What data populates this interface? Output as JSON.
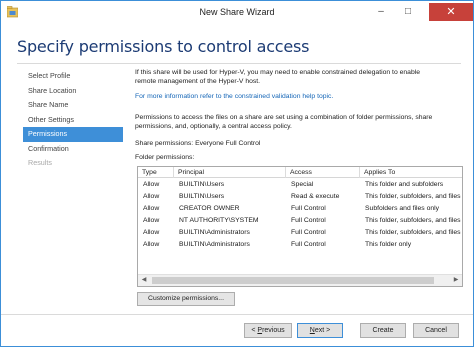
{
  "window": {
    "title": "New Share Wizard",
    "minimize": "–",
    "maximize": "□",
    "close": "✕"
  },
  "header": {
    "title": "Specify permissions to control access"
  },
  "nav": {
    "items": [
      {
        "label": "Select Profile",
        "state": "normal"
      },
      {
        "label": "Share Location",
        "state": "normal"
      },
      {
        "label": "Share Name",
        "state": "normal"
      },
      {
        "label": "Other Settings",
        "state": "normal"
      },
      {
        "label": "Permissions",
        "state": "active"
      },
      {
        "label": "Confirmation",
        "state": "normal"
      },
      {
        "label": "Results",
        "state": "disabled"
      }
    ]
  },
  "content": {
    "hyperv_line1": "If this share will be used for Hyper-V, you may need to enable constrained delegation to enable",
    "hyperv_line2": "remote management of the Hyper-V host.",
    "hyperv_link": "For more information refer to the constrained validation help topic.",
    "access_line1": "Permissions to access the files on a share are set using a combination of folder permissions, share",
    "access_line2": "permissions, and, optionally, a central access policy.",
    "share_permissions": "Share permissions: Everyone Full Control",
    "folder_permissions_label": "Folder permissions:"
  },
  "permissions_table": {
    "columns": [
      "Type",
      "Principal",
      "Access",
      "Applies To"
    ],
    "rows": [
      {
        "type": "Allow",
        "principal": "BUILTIN\\Users",
        "access": "Special",
        "applies_to": "This folder and subfolders"
      },
      {
        "type": "Allow",
        "principal": "BUILTIN\\Users",
        "access": "Read & execute",
        "applies_to": "This folder, subfolders, and files"
      },
      {
        "type": "Allow",
        "principal": "CREATOR OWNER",
        "access": "Full Control",
        "applies_to": "Subfolders and files only"
      },
      {
        "type": "Allow",
        "principal": "NT AUTHORITY\\SYSTEM",
        "access": "Full Control",
        "applies_to": "This folder, subfolders, and files"
      },
      {
        "type": "Allow",
        "principal": "BUILTIN\\Administrators",
        "access": "Full Control",
        "applies_to": "This folder, subfolders, and files"
      },
      {
        "type": "Allow",
        "principal": "BUILTIN\\Administrators",
        "access": "Full Control",
        "applies_to": "This folder only"
      }
    ]
  },
  "buttons": {
    "customize": "Customize permissions...",
    "previous_arrow": "< ",
    "previous_key": "P",
    "previous_rest": "revious",
    "next_key": "N",
    "next_rest": "ext >",
    "create": "Create",
    "cancel": "Cancel"
  },
  "icons": {
    "app": "share-folder-icon",
    "scroll_left": "chevron-left-icon",
    "scroll_right": "chevron-right-icon"
  },
  "colors": {
    "accent": "#3e8fd8",
    "header_title": "#1c3b74",
    "link": "#1566b7",
    "close_button": "#c7413a"
  }
}
